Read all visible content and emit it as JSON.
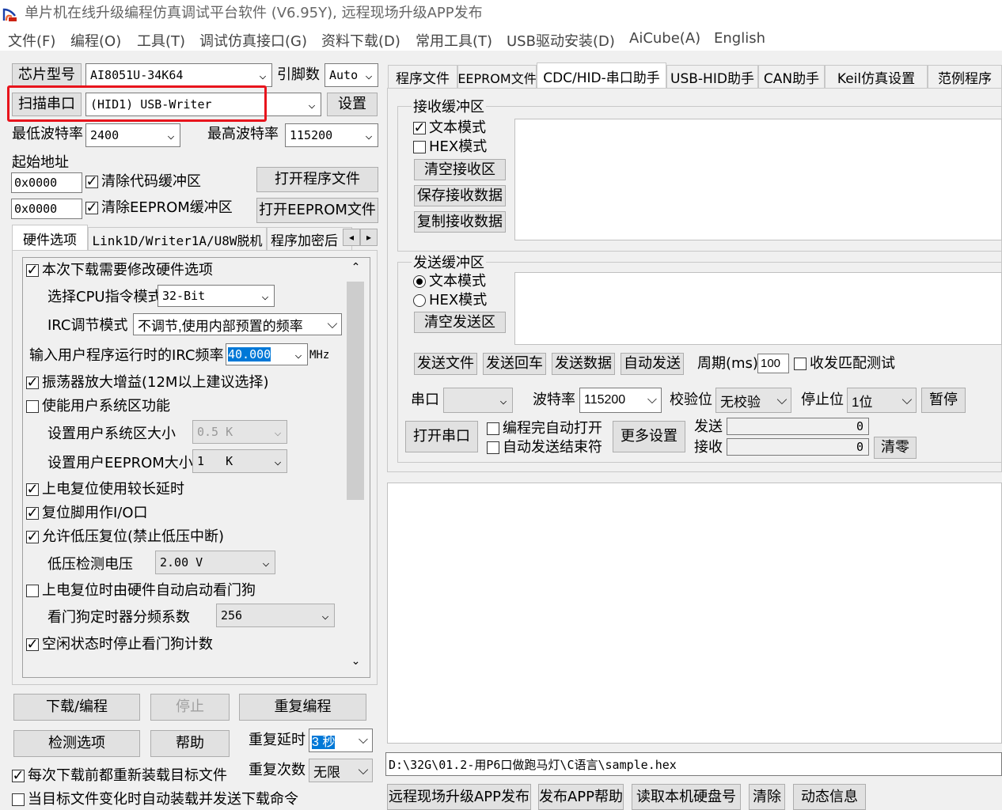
{
  "window": {
    "title": "单片机在线升级编程仿真调试平台软件 (V6.95Y), 远程现场升级APP发布"
  },
  "menu": [
    "文件(F)",
    "编程(O)",
    "工具(T)",
    "调试仿真接口(G)",
    "资料下载(D)",
    "常用工具(T)",
    "USB驱动安装(D)",
    "AiCube(A)",
    "English"
  ],
  "left": {
    "chip_label": "芯片型号",
    "chip_value": "AI8051U-34K64",
    "pins_label": "引脚数",
    "pins_value": "Auto",
    "scan_btn": "扫描串口",
    "port_value": "(HID1) USB-Writer",
    "settings_btn": "设置",
    "min_baud_label": "最低波特率",
    "min_baud_value": "2400",
    "max_baud_label": "最高波特率",
    "max_baud_value": "115200",
    "start_addr_label": "起始地址",
    "addr1": "0x0000",
    "addr2": "0x0000",
    "clear_code": "清除代码缓冲区",
    "clear_eeprom": "清除EEPROM缓冲区",
    "open_prog": "打开程序文件",
    "open_eeprom": "打开EEPROM文件",
    "tabs": [
      "硬件选项",
      "Link1D/Writer1A/U8W脱机",
      "程序加密后"
    ],
    "hw": {
      "modify": "本次下载需要修改硬件选项",
      "cpu_mode_label": "选择CPU指令模式",
      "cpu_mode_value": "32-Bit",
      "irc_mode_label": "IRC调节模式",
      "irc_mode_value": "不调节,使用内部预置的频率",
      "irc_freq_label": "输入用户程序运行时的IRC频率",
      "irc_freq_value": "40.000",
      "irc_unit": "MHz",
      "osc_gain": "振荡器放大增益(12M以上建议选择)",
      "user_sys": "使能用户系统区功能",
      "user_sys_size_label": "设置用户系统区大小",
      "user_sys_size_value": "0.5 K",
      "eeprom_size_label": "设置用户EEPROM大小",
      "eeprom_size_value": "1   K",
      "long_delay": "上电复位使用较长延时",
      "reset_io": "复位脚用作I/O口",
      "lvr": "允许低压复位(禁止低压中断)",
      "lv_label": "低压检测电压",
      "lv_value": "2.00 V",
      "wdt_auto": "上电复位时由硬件自动启动看门狗",
      "wdt_div_label": "看门狗定时器分频系数",
      "wdt_div_value": "256",
      "wdt_idle": "空闲状态时停止看门狗计数"
    },
    "download_btn": "下载/编程",
    "stop_btn": "停止",
    "repeat_btn": "重复编程",
    "check_btn": "检测选项",
    "help_btn": "帮助",
    "repeat_delay_label": "重复延时",
    "repeat_delay_value": "3 秒",
    "repeat_count_label": "重复次数",
    "repeat_count_value": "无限",
    "reload_each": "每次下载前都重新装载目标文件",
    "auto_reload": "当目标文件变化时自动装载并发送下载命令"
  },
  "right": {
    "tabs": [
      "程序文件",
      "EEPROM文件",
      "CDC/HID-串口助手",
      "USB-HID助手",
      "CAN助手",
      "Keil仿真设置",
      "范例程序"
    ],
    "recv_group": "接收缓冲区",
    "recv_text": "文本模式",
    "recv_hex": "HEX模式",
    "clear_recv": "清空接收区",
    "save_recv": "保存接收数据",
    "copy_recv": "复制接收数据",
    "send_group": "发送缓冲区",
    "send_text": "文本模式",
    "send_hex": "HEX模式",
    "clear_send": "清空发送区",
    "send_file": "发送文件",
    "send_return": "发送回车",
    "send_data": "发送数据",
    "auto_send": "自动发送",
    "period_label": "周期(ms)",
    "period_value": "100",
    "match_test": "收发匹配测试",
    "port_label": "串口",
    "port_value": "",
    "baud_label": "波特率",
    "baud_value": "115200",
    "parity_label": "校验位",
    "parity_value": "无校验",
    "stop_label": "停止位",
    "stop_value": "1位",
    "pause_btn": "暂停",
    "open_port": "打开串口",
    "auto_open": "编程完自动打开",
    "auto_end": "自动发送结束符",
    "more": "更多设置",
    "send_label": "发送",
    "send_count": "0",
    "recv_label": "接收",
    "recv_count": "0",
    "zero_btn": "清零",
    "file_path": "D:\\32G\\01.2-用P6口做跑马灯\\C语言\\sample.hex",
    "bottom_btns": [
      "远程现场升级APP发布",
      "发布APP帮助",
      "读取本机硬盘号",
      "清除",
      "动态信息"
    ]
  },
  "colors": {
    "highlight_border": "#e8141c",
    "selection": "#0078d7",
    "window_bg": "#f0f0f0"
  }
}
